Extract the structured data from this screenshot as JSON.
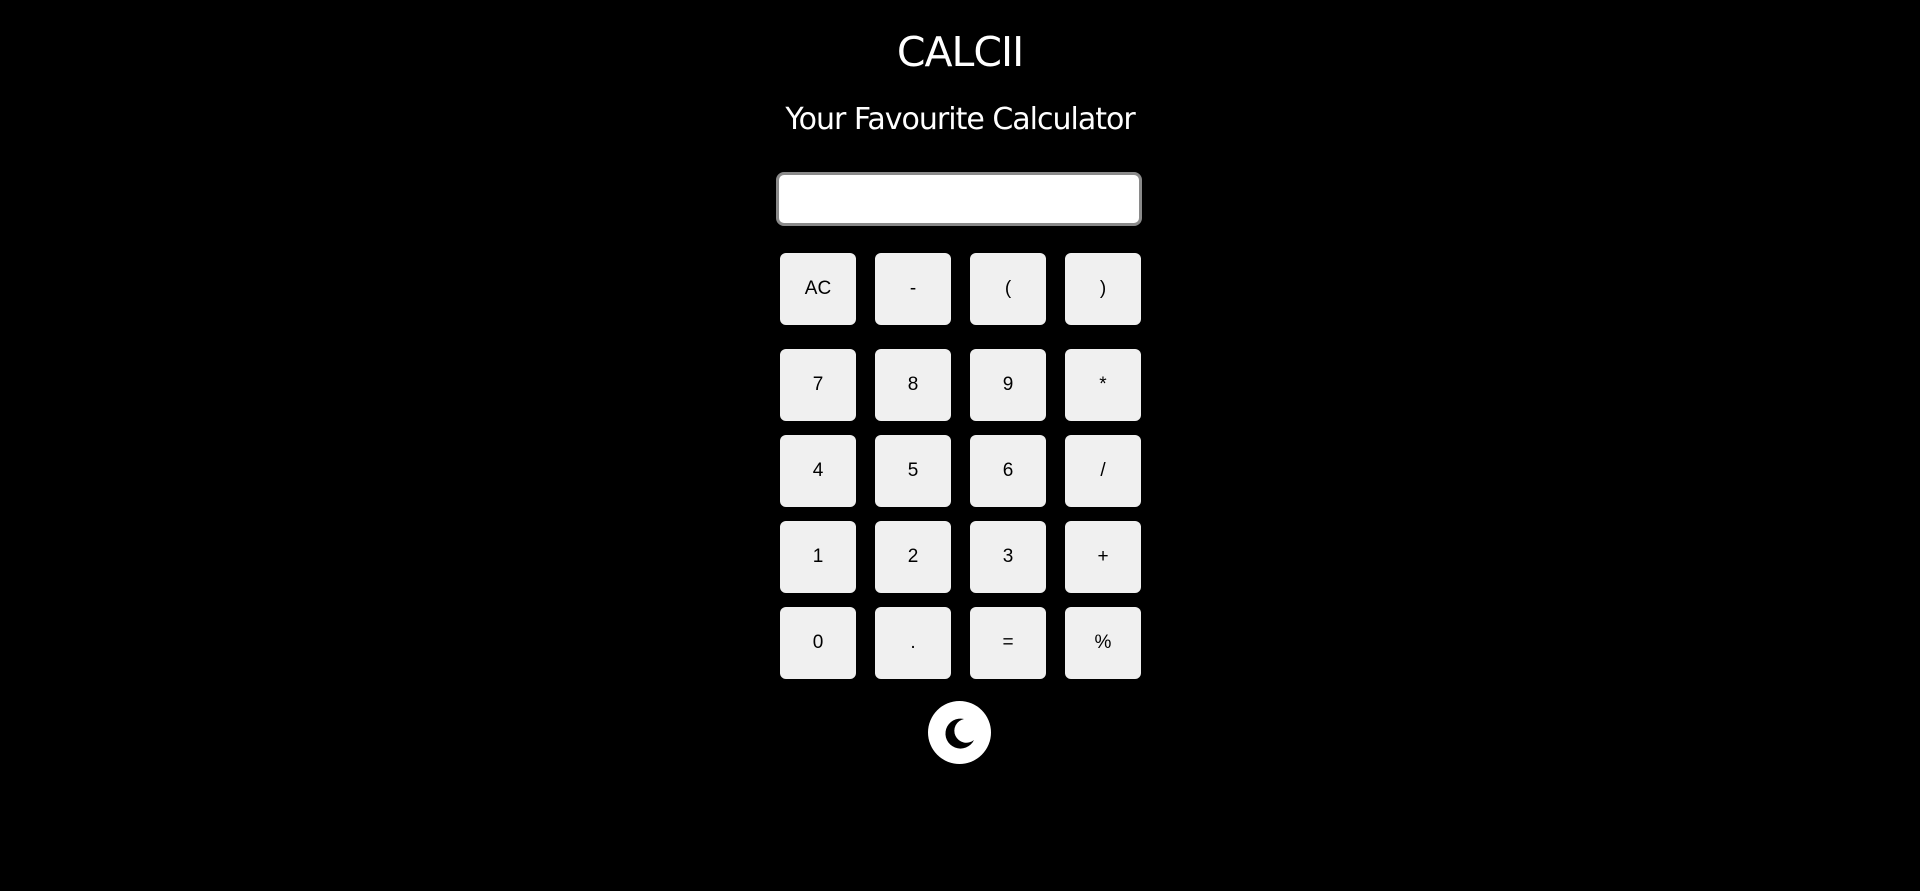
{
  "header": {
    "title": "CALCII",
    "subtitle": "Your Favourite Calculator"
  },
  "display": {
    "value": "",
    "placeholder": ""
  },
  "keys": [
    [
      "AC",
      "-",
      "(",
      ")"
    ],
    [
      "7",
      "8",
      "9",
      "*"
    ],
    [
      "4",
      "5",
      "6",
      "/"
    ],
    [
      "1",
      "2",
      "3",
      "+"
    ],
    [
      "0",
      ".",
      "=",
      "%"
    ]
  ],
  "theme_toggle": {
    "icon": "moon-icon"
  },
  "colors": {
    "background": "#000000",
    "key_background": "#f0f0f0",
    "text_light": "#ffffff"
  }
}
